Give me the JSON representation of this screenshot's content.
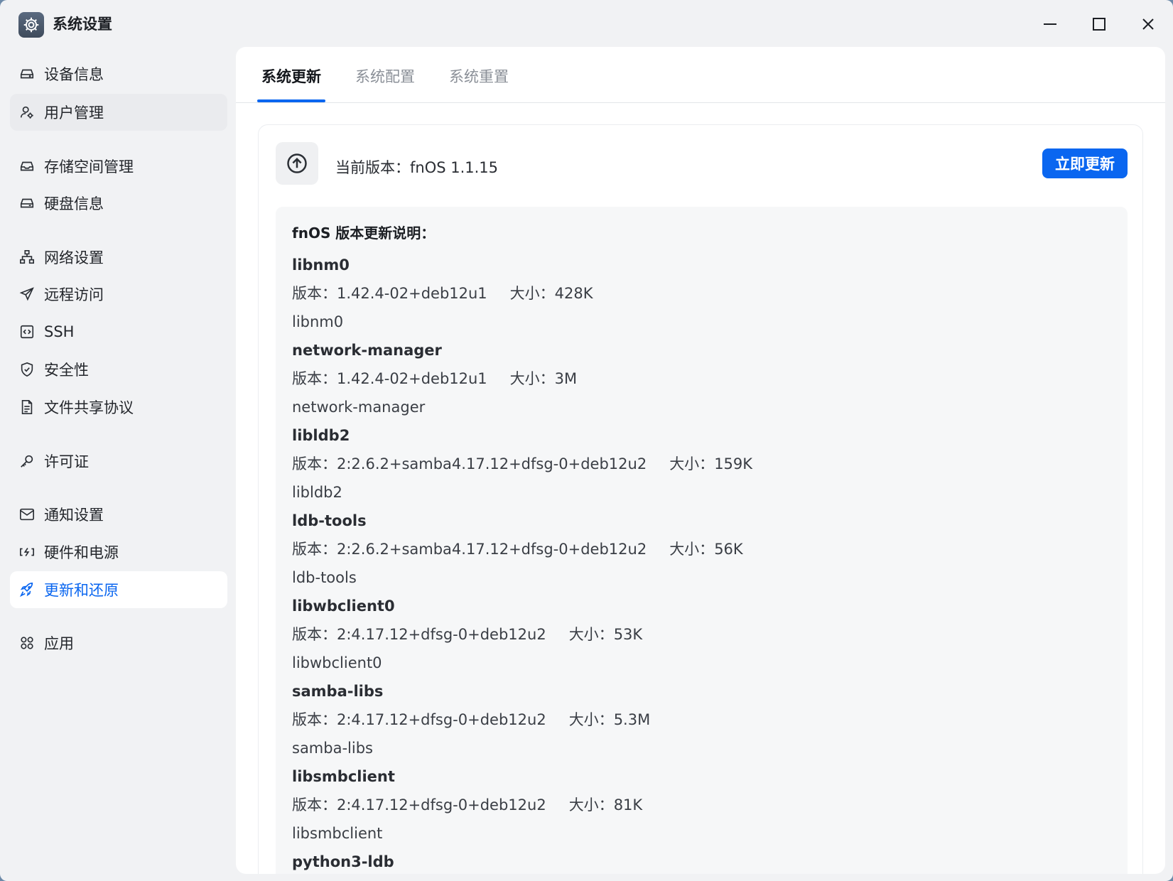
{
  "window": {
    "title": "系统设置"
  },
  "sidebar": {
    "items": [
      {
        "label": "设备信息",
        "icon": "device-icon"
      },
      {
        "label": "用户管理",
        "icon": "user-icon"
      },
      {
        "label": "存储空间管理",
        "icon": "storage-icon"
      },
      {
        "label": "硬盘信息",
        "icon": "disk-icon"
      },
      {
        "label": "网络设置",
        "icon": "network-icon"
      },
      {
        "label": "远程访问",
        "icon": "send-icon"
      },
      {
        "label": "SSH",
        "icon": "code-icon"
      },
      {
        "label": "安全性",
        "icon": "shield-icon"
      },
      {
        "label": "文件共享协议",
        "icon": "document-icon"
      },
      {
        "label": "许可证",
        "icon": "key-icon"
      },
      {
        "label": "通知设置",
        "icon": "mail-icon"
      },
      {
        "label": "硬件和电源",
        "icon": "power-icon"
      },
      {
        "label": "更新和还原",
        "icon": "rocket-icon"
      },
      {
        "label": "应用",
        "icon": "apps-icon"
      }
    ],
    "active_index": 12
  },
  "tabs": [
    {
      "label": "系统更新",
      "active": true
    },
    {
      "label": "系统配置",
      "active": false
    },
    {
      "label": "系统重置",
      "active": false
    }
  ],
  "update": {
    "version_text": "当前版本：fnOS 1.1.15",
    "button_label": "立即更新"
  },
  "notes": {
    "title": "fnOS 版本更新说明：",
    "version_prefix": "版本：",
    "size_prefix": "大小：",
    "packages": [
      {
        "name": "libnm0",
        "version": "1.42.4-02+deb12u1",
        "size": "428K",
        "desc": "libnm0"
      },
      {
        "name": "network-manager",
        "version": "1.42.4-02+deb12u1",
        "size": "3M",
        "desc": "network-manager"
      },
      {
        "name": "libldb2",
        "version": "2:2.6.2+samba4.17.12+dfsg-0+deb12u2",
        "size": "159K",
        "desc": "libldb2"
      },
      {
        "name": "ldb-tools",
        "version": "2:2.6.2+samba4.17.12+dfsg-0+deb12u2",
        "size": "56K",
        "desc": "ldb-tools"
      },
      {
        "name": "libwbclient0",
        "version": "2:4.17.12+dfsg-0+deb12u2",
        "size": "53K",
        "desc": "libwbclient0"
      },
      {
        "name": "samba-libs",
        "version": "2:4.17.12+dfsg-0+deb12u2",
        "size": "5.3M",
        "desc": "samba-libs"
      },
      {
        "name": "libsmbclient",
        "version": "2:4.17.12+dfsg-0+deb12u2",
        "size": "81K",
        "desc": "libsmbclient"
      },
      {
        "name": "python3-ldb",
        "version": "",
        "size": "",
        "desc": ""
      }
    ]
  },
  "colors": {
    "accent": "#0a66f0",
    "sidebar_bg": "#f1f2f4",
    "notes_bg": "#f6f7f8"
  }
}
